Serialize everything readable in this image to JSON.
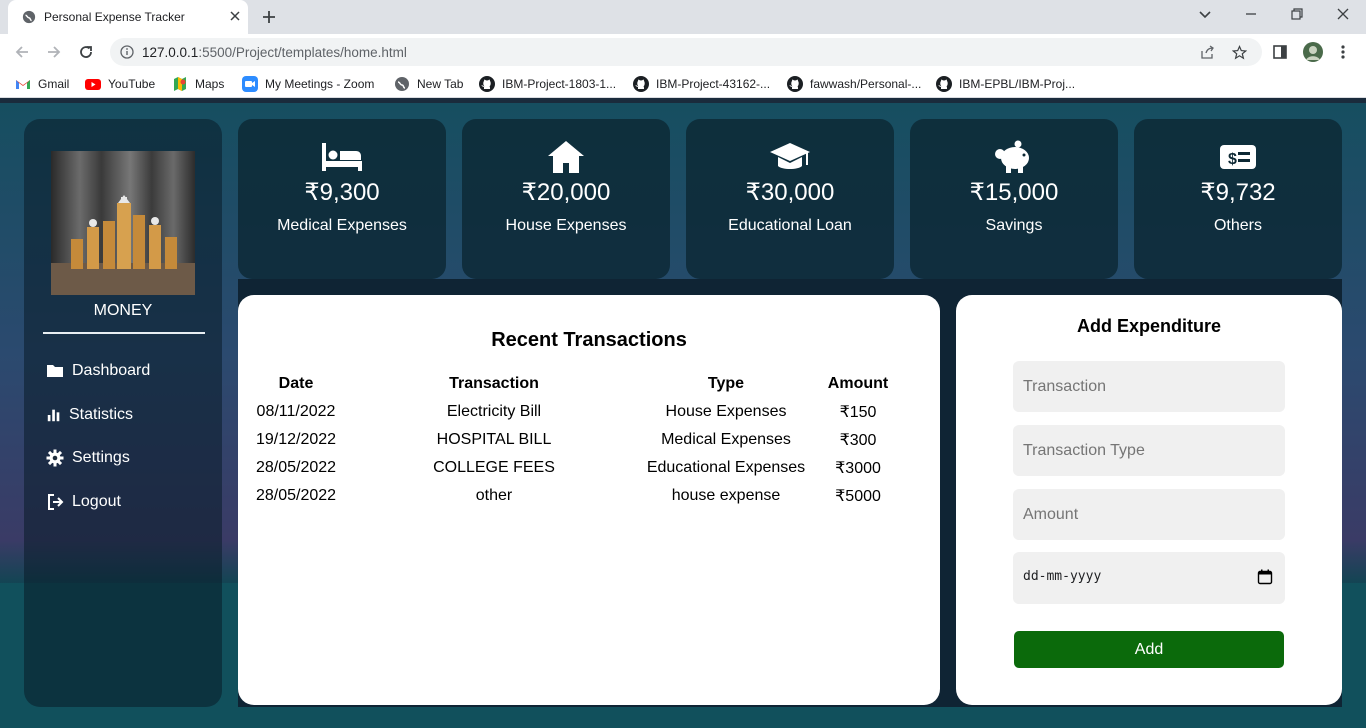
{
  "browser": {
    "tab_title": "Personal Expense Tracker",
    "url_host": "127.0.0.1",
    "url_path": ":5500/Project/templates/home.html",
    "bookmarks": [
      {
        "label": "Gmail",
        "icon": "gmail-icon"
      },
      {
        "label": "YouTube",
        "icon": "youtube-icon"
      },
      {
        "label": "Maps",
        "icon": "maps-icon"
      },
      {
        "label": "My Meetings - Zoom",
        "icon": "zoom-icon"
      },
      {
        "label": "New Tab",
        "icon": "globe-icon"
      },
      {
        "label": "IBM-Project-1803-1...",
        "icon": "github-icon"
      },
      {
        "label": "IBM-Project-43162-...",
        "icon": "github-icon"
      },
      {
        "label": "fawwash/Personal-...",
        "icon": "github-icon"
      },
      {
        "label": "IBM-EPBL/IBM-Proj...",
        "icon": "github-icon"
      }
    ]
  },
  "sidebar": {
    "brand": "MONEY",
    "items": [
      {
        "label": "Dashboard",
        "icon": "folder-icon"
      },
      {
        "label": "Statistics",
        "icon": "bar-chart-icon"
      },
      {
        "label": "Settings",
        "icon": "gear-icon"
      },
      {
        "label": "Logout",
        "icon": "logout-icon"
      }
    ]
  },
  "cards": [
    {
      "amount": "₹9,300",
      "label": "Medical Expenses",
      "icon": "bed-icon"
    },
    {
      "amount": "₹20,000",
      "label": "House Expenses",
      "icon": "house-icon"
    },
    {
      "amount": "₹30,000",
      "label": "Educational Loan",
      "icon": "graduation-cap-icon"
    },
    {
      "amount": "₹15,000",
      "label": "Savings",
      "icon": "piggy-bank-icon"
    },
    {
      "amount": "₹9,732",
      "label": "Others",
      "icon": "money-bill-icon"
    }
  ],
  "transactions": {
    "title": "Recent Transactions",
    "headers": {
      "date": "Date",
      "transaction": "Transaction",
      "type": "Type",
      "amount": "Amount"
    },
    "rows": [
      {
        "date": "08/11/2022",
        "transaction": "Electricity Bill",
        "type": "House Expenses",
        "amount": "₹150"
      },
      {
        "date": "19/12/2022",
        "transaction": "HOSPITAL BILL",
        "type": "Medical Expenses",
        "amount": "₹300"
      },
      {
        "date": "28/05/2022",
        "transaction": "COLLEGE FEES",
        "type": "Educational Expenses",
        "amount": "₹3000"
      },
      {
        "date": "28/05/2022",
        "transaction": "other",
        "type": "house expense",
        "amount": "₹5000"
      }
    ]
  },
  "add_form": {
    "title": "Add Expenditure",
    "transaction_placeholder": "Transaction",
    "type_placeholder": "Transaction Type",
    "amount_placeholder": "Amount",
    "date_placeholder": "dd-mm-yyyy",
    "button_label": "Add"
  },
  "colors": {
    "accent_button": "#0b6a0b",
    "card_bg": "#0c2834",
    "panel_bg": "#ffffff"
  }
}
